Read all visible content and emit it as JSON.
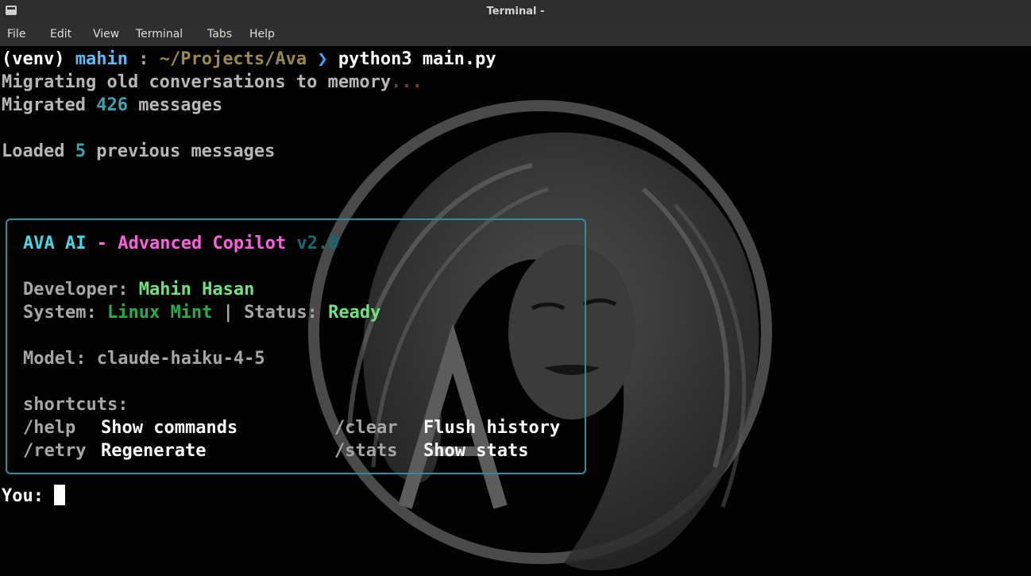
{
  "window": {
    "title": "Terminal -"
  },
  "menu": [
    "File",
    "Edit",
    "View",
    "Terminal",
    "Tabs",
    "Help"
  ],
  "prompt": {
    "venv": "(venv)",
    "user": "mahin",
    "sep": ":",
    "path": "~/Projects/Ava",
    "arrow": "❯",
    "command": "python3 main.py"
  },
  "output": {
    "migrating_text": "Migrating old conversations to memory",
    "migrating_dots": "...",
    "migrated_prefix": "Migrated",
    "migrated_count": "426",
    "migrated_suffix": "messages",
    "loaded_prefix": "Loaded",
    "loaded_count": "5",
    "loaded_suffix": "previous messages"
  },
  "panel": {
    "title_ava": "AVA AI",
    "title_dash": "-",
    "title_copilot": "Advanced Copilot",
    "title_version": "v2.0",
    "developer_label": "Developer:",
    "developer_value": "Mahin Hasan",
    "system_label": "System:",
    "system_value": "Linux Mint",
    "pipe": "|",
    "status_label": "Status:",
    "status_value": "Ready",
    "model_label": "Model:",
    "model_value": "claude-haiku-4-5",
    "shortcuts_label": "shortcuts:",
    "shortcuts": [
      {
        "cmd": "/help",
        "desc": "Show commands"
      },
      {
        "cmd": "/clear",
        "desc": "Flush history"
      },
      {
        "cmd": "/retry",
        "desc": "Regenerate"
      },
      {
        "cmd": "/stats",
        "desc": "Show stats"
      }
    ]
  },
  "input": {
    "label": "You:"
  },
  "colors": {
    "background": "#020202",
    "panel_border": "#2a8f9a",
    "accent_cyan": "#43d9e6",
    "accent_pink": "#ff5fe0",
    "accent_green": "#6ee47c"
  },
  "icons": {
    "window_icon": "terminal-icon",
    "background_logo": "ava-portrait-logo"
  }
}
